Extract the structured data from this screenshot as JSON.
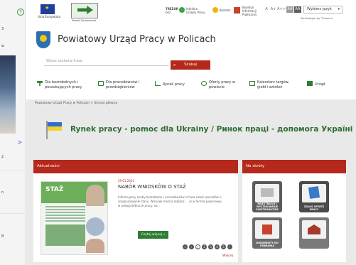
{
  "left_window": {
    "help_icon": "question-circle-icon",
    "lines": [
      "3",
      "w",
      "2",
      "n",
      "B",
      ">"
    ]
  },
  "topbar": {
    "eu_caption": "Unia Europejska",
    "pz_caption": "Powiat Zarządzania",
    "trezor_line1": "TREZOR",
    "trezor_line2": "bez",
    "infolinia_line1": "Infolinia",
    "infolinia_line2": "Urzędu Pracy",
    "kontakt": "Kontakt",
    "bip_line1": "Biuletyn",
    "bip_line2": "Informacji",
    "bip_line3": "Publicznej",
    "font_small": "A",
    "font_medium": "A+",
    "font_large": "A++",
    "contrast_a": "AA",
    "contrast_b": "AA",
    "language_label": "Wybierz język",
    "language_chevron": "▾",
    "tech_line": "Technologia: by: Theme.cr"
  },
  "header": {
    "site_title": "Powiatowy Urząd Pracy w Policach",
    "search_placeholder": "Wpisz szukaną frazę",
    "search_button": "Szukaj"
  },
  "nav": {
    "items": [
      {
        "line1": "Dla bezrobotnych i",
        "line2": "poszukujących pracy"
      },
      {
        "line1": "Dla pracodawców i",
        "line2": "przedsiębiorców"
      },
      {
        "line1": "Rynek pracy",
        "line2": ""
      },
      {
        "line1": "Oferty pracy w",
        "line2": "powiecie"
      },
      {
        "line1": "Kalendarz targów,",
        "line2": "giełd i szkoleń"
      },
      {
        "line1": "Urząd",
        "line2": ""
      }
    ]
  },
  "breadcrumb": "Powiatowy Urząd Pracy w Policach  >  Strona główna",
  "banner": "Rynek pracy - pomoc dla Ukrainy / Ринок праці - допомога Україні",
  "news": {
    "header": "Aktualności",
    "poster_title": "STAŻ",
    "date": "29.01.2024",
    "title": "NABÓR WNIOSKÓW O STAŻ",
    "body": "Informujemy osoby bezrobotne i pracodawców iż trwa nabór wniosków o zorganizowanie stażu. Wniosek można składać ... al w formie papierowej w pokojach/biurze pracy. na...",
    "read_more": "Czytaj więcej »",
    "pager": [
      "«",
      "‹",
      "1",
      "2",
      "3",
      "4",
      "5",
      "›"
    ],
    "more_link": "Więcej"
  },
  "shortcuts": {
    "header": "Na skróty",
    "tiles": [
      {
        "label": "REJESTRACJA I WYSZUKIWANIE ELEKTRONICZNE"
      },
      {
        "label": "ZGŁOŚ OFERTĘ PRACY"
      },
      {
        "label": "DOKUMENTY DO POBRANIA"
      },
      {
        "label": ""
      }
    ]
  }
}
